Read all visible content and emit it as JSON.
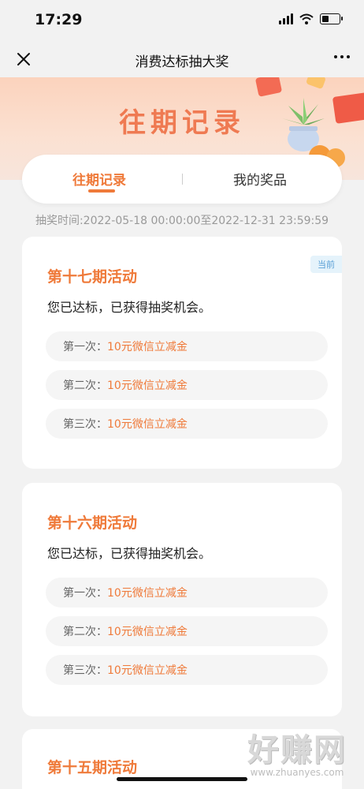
{
  "status_bar": {
    "time": "17:29"
  },
  "navbar": {
    "title": "消费达标抽大奖",
    "close_icon": "close-icon",
    "more_icon": "more-dots-icon"
  },
  "banner": {
    "title": "往期记录"
  },
  "tabs": [
    {
      "label": "往期记录",
      "active": true
    },
    {
      "label": "我的奖品",
      "active": false
    }
  ],
  "period": "抽奖时间:2022-05-18 00:00:00至2022-12-31 23:59:59",
  "cards": [
    {
      "badge": "当前",
      "title": "第十七期活动",
      "message": "您已达标，已获得抽奖机会。",
      "draws": [
        {
          "label": "第一次：",
          "value": "10元微信立减金"
        },
        {
          "label": "第二次：",
          "value": "10元微信立减金"
        },
        {
          "label": "第三次：",
          "value": "10元微信立减金"
        }
      ]
    },
    {
      "title": "第十六期活动",
      "message": "您已达标，已获得抽奖机会。",
      "draws": [
        {
          "label": "第一次：",
          "value": "10元微信立减金"
        },
        {
          "label": "第二次：",
          "value": "10元微信立减金"
        },
        {
          "label": "第三次：",
          "value": "10元微信立减金"
        }
      ]
    },
    {
      "title": "第十五期活动"
    }
  ],
  "watermark": {
    "main": "好赚网",
    "site": "www.zhuanyes.com"
  },
  "colors": {
    "accent": "#ef7a3a",
    "banner_title": "#ef7a52",
    "badge_bg": "#e5f3fb",
    "badge_text": "#5aa0d6"
  }
}
